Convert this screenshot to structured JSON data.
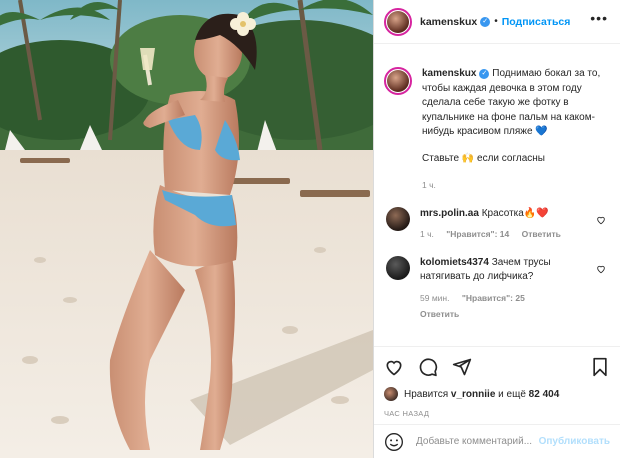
{
  "header": {
    "username": "kamenskux",
    "dot": "•",
    "follow_label": "Подписаться",
    "more_icon": "more-horizontal-icon"
  },
  "caption": {
    "username": "kamenskux",
    "text": "Поднимаю бокал за то, чтобы каждая девочка в этом году сделала себе такую же фотку в купальнике на фоне пальм на каком-нибудь красивом пляже 💙",
    "text2": "Ставьте 🙌 если согласны",
    "time": "1 ч."
  },
  "comments": [
    {
      "username": "mrs.polin.aa",
      "text": "Красотка🔥❤️",
      "time": "1 ч.",
      "likes": "\"Нравится\": 14",
      "reply": "Ответить"
    },
    {
      "username": "kolomiets4374",
      "text": "Зачем трусы натягивать до лифчика?",
      "time": "59 мин.",
      "likes": "\"Нравится\": 25",
      "reply": "Ответить"
    }
  ],
  "actions": {
    "icons": [
      "heart-icon",
      "comment-icon",
      "share-icon",
      "bookmark-icon"
    ]
  },
  "likes": {
    "prefix": "Нравится",
    "user": "v_ronniie",
    "suffix": "и ещё",
    "count": "82 404"
  },
  "posted_ago": "ЧАС НАЗАД",
  "add_comment": {
    "placeholder": "Добавьте комментарий...",
    "publish_label": "Опубликовать",
    "emoji_icon": "smile-icon"
  },
  "colors": {
    "accent": "#0095f6",
    "verified": "#3897f0",
    "swimsuit": "#5aa9d6",
    "sand": "#efe6da"
  }
}
